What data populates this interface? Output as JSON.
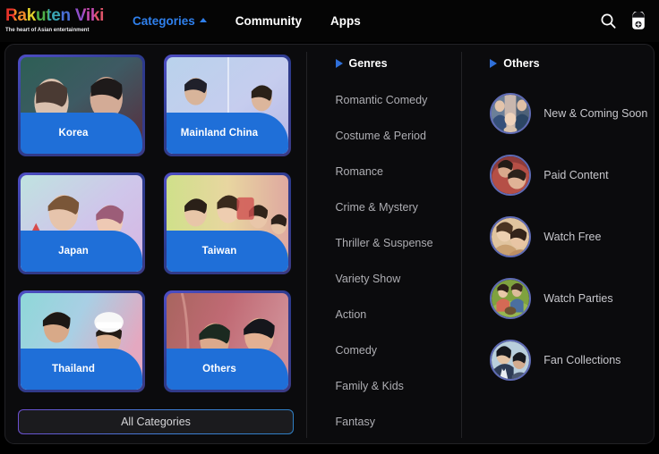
{
  "brand": {
    "word": "Rakuten Viki",
    "tagline": "The heart of Asian entertainment"
  },
  "nav": {
    "items": [
      {
        "label": "Categories",
        "active": true,
        "caret": "caret-up-icon"
      },
      {
        "label": "Community",
        "active": false
      },
      {
        "label": "Apps",
        "active": false
      }
    ],
    "right_icons": [
      {
        "name": "search-icon"
      },
      {
        "name": "account-avatar-icon"
      }
    ]
  },
  "colors": {
    "accent_blue": "#2f80ed",
    "label_blue": "#1f6fd8",
    "panel_bg": "#0b0b0d",
    "page_bg": "#000000",
    "avatar_ring": "#5f6bb5"
  },
  "countries": {
    "cards": [
      {
        "label": "Korea",
        "art": "korea-thumb"
      },
      {
        "label": "Mainland China",
        "art": "mainland-china-thumb"
      },
      {
        "label": "Japan",
        "art": "japan-thumb"
      },
      {
        "label": "Taiwan",
        "art": "taiwan-thumb"
      },
      {
        "label": "Thailand",
        "art": "thailand-thumb"
      },
      {
        "label": "Others",
        "art": "others-thumb"
      }
    ],
    "all_categories_label": "All Categories"
  },
  "genres": {
    "heading": "Genres",
    "items": [
      "Romantic Comedy",
      "Costume & Period",
      "Romance",
      "Crime & Mystery",
      "Thriller & Suspense",
      "Variety Show",
      "Action",
      "Comedy",
      "Family & Kids",
      "Fantasy"
    ]
  },
  "others": {
    "heading": "Others",
    "items": [
      {
        "label": "New & Coming Soon",
        "art": "new-coming-soon-thumb"
      },
      {
        "label": "Paid Content",
        "art": "paid-content-thumb"
      },
      {
        "label": "Watch Free",
        "art": "watch-free-thumb"
      },
      {
        "label": "Watch Parties",
        "art": "watch-parties-thumb"
      },
      {
        "label": "Fan Collections",
        "art": "fan-collections-thumb"
      }
    ]
  }
}
